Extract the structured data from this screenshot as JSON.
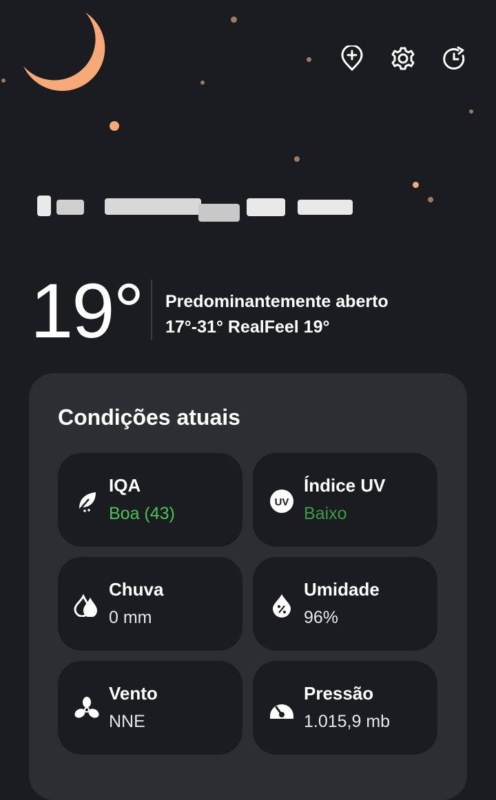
{
  "header": {
    "location": "",
    "actions": [
      {
        "name": "add-location",
        "icon": "map-pin-plus-icon"
      },
      {
        "name": "settings",
        "icon": "gear-icon"
      },
      {
        "name": "refresh",
        "icon": "clock-refresh-icon"
      }
    ]
  },
  "current": {
    "temperature": "19°",
    "condition": "Predominantemente aberto",
    "range_realfeel": "17°-31° RealFeel 19°"
  },
  "conditions": {
    "title": "Condições atuais",
    "tiles": [
      {
        "label": "IQA",
        "value": "Boa (43)",
        "icon": "leaf-icon",
        "value_color": "#4cc15a"
      },
      {
        "label": "Índice UV",
        "value": "Baixo",
        "icon": "uv-icon",
        "value_color": "#3d9a48"
      },
      {
        "label": "Chuva",
        "value": "0 mm",
        "icon": "rain-drops-icon"
      },
      {
        "label": "Umidade",
        "value": "96%",
        "icon": "humidity-drop-icon"
      },
      {
        "label": "Vento",
        "value": "NNE",
        "icon": "fan-icon"
      },
      {
        "label": "Pressão",
        "value": "1.015,9 mb",
        "icon": "gauge-icon"
      }
    ]
  },
  "colors": {
    "background": "#1b1c1f",
    "card": "#2c2e32",
    "moon": "#f7a978",
    "good": "#4cc15a"
  }
}
